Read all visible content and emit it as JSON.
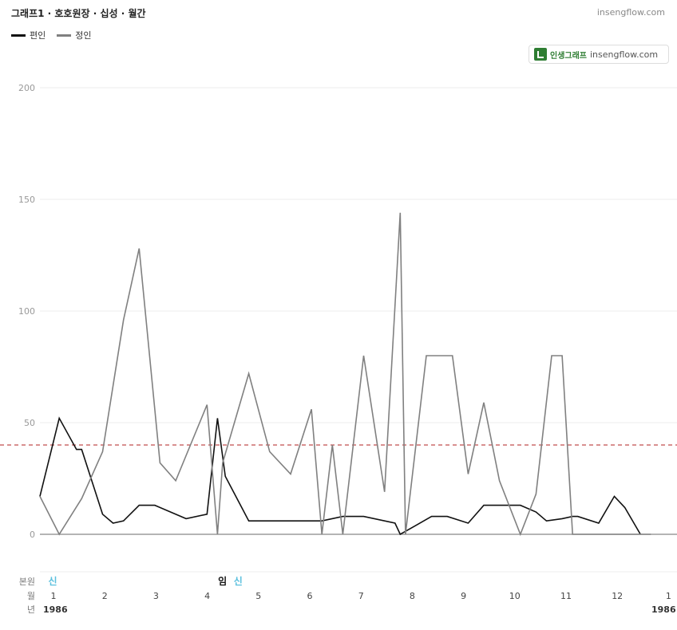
{
  "header": {
    "title": "그래프1 · 호호원장 · 십성 · 월간",
    "site": "insengflow.com"
  },
  "badge": {
    "name": "인생그래프",
    "url": "insengflow.com"
  },
  "colors": {
    "series_pyeonin": "#111111",
    "series_jeongin": "#808080",
    "threshold": "#b22222",
    "sinsal_sin": "#5bc0de",
    "sinsal_im": "#111111"
  },
  "row_labels": {
    "bonwon": "본원",
    "month": "월",
    "year": "년"
  },
  "month_ticks": [
    {
      "label": "1",
      "x": 1
    },
    {
      "label": "2",
      "x": 2
    },
    {
      "label": "3",
      "x": 3
    },
    {
      "label": "4",
      "x": 4
    },
    {
      "label": "5",
      "x": 5
    },
    {
      "label": "6",
      "x": 6
    },
    {
      "label": "7",
      "x": 7
    },
    {
      "label": "8",
      "x": 8
    },
    {
      "label": "9",
      "x": 9
    },
    {
      "label": "10",
      "x": 10
    },
    {
      "label": "11",
      "x": 11
    },
    {
      "label": "12",
      "x": 12
    },
    {
      "label": "1",
      "x": 13
    }
  ],
  "year_ticks": [
    {
      "label": "1986",
      "x": 1
    },
    {
      "label": "1986",
      "x": 13
    }
  ],
  "bonwon_marks": [
    {
      "text": "신",
      "x": 0.9,
      "kind": "sin"
    },
    {
      "text": "임",
      "x": 4.15,
      "kind": "im"
    },
    {
      "text": "신",
      "x": 4.45,
      "kind": "sin"
    }
  ],
  "chart_data": {
    "type": "line",
    "title": "그래프1 · 호호원장 · 십성 · 월간",
    "xlabel": "",
    "ylabel": "",
    "xlim": [
      0.8,
      13.0
    ],
    "ylim": [
      0,
      200
    ],
    "yticks": [
      0,
      50,
      100,
      150,
      200
    ],
    "grid": true,
    "legend_position": "top-left",
    "threshold": 40,
    "series": [
      {
        "name": "편인",
        "color": "#111111",
        "x": [
          0.8,
          1.17,
          1.5,
          1.6,
          2.0,
          2.2,
          2.4,
          2.7,
          3.0,
          3.3,
          3.6,
          4.0,
          4.2,
          4.35,
          4.8,
          5.0,
          5.5,
          6.2,
          6.6,
          7.0,
          7.6,
          7.7,
          8.0,
          8.3,
          8.6,
          9.0,
          9.3,
          9.6,
          10.0,
          10.3,
          10.5,
          10.8,
          11.0,
          11.1,
          11.5,
          11.8,
          12.0,
          12.3
        ],
        "values": [
          17,
          52,
          38,
          38,
          9,
          5,
          6,
          13,
          13,
          10,
          7,
          9,
          52,
          26,
          6,
          6,
          6,
          6,
          8,
          8,
          5,
          0,
          4,
          8,
          8,
          5,
          13,
          13,
          13,
          10,
          6,
          7,
          8,
          8,
          5,
          17,
          12,
          0
        ]
      },
      {
        "name": "정인",
        "color": "#808080",
        "x": [
          0.8,
          1.17,
          1.6,
          2.0,
          2.4,
          2.7,
          3.1,
          3.4,
          4.0,
          4.2,
          4.3,
          4.8,
          5.2,
          5.6,
          6.0,
          6.2,
          6.4,
          6.6,
          7.0,
          7.4,
          7.7,
          7.8,
          8.2,
          8.7,
          9.0,
          9.3,
          9.6,
          10.0,
          10.3,
          10.6,
          10.8,
          11.0,
          11.5,
          11.8,
          12.0,
          12.5
        ],
        "values": [
          17,
          0,
          16,
          37,
          96,
          128,
          32,
          24,
          58,
          0,
          32,
          72,
          37,
          27,
          56,
          0,
          40,
          0,
          80,
          19,
          144,
          0,
          80,
          80,
          27,
          59,
          24,
          0,
          18,
          80,
          80,
          0,
          0,
          0,
          0,
          0
        ]
      }
    ]
  }
}
